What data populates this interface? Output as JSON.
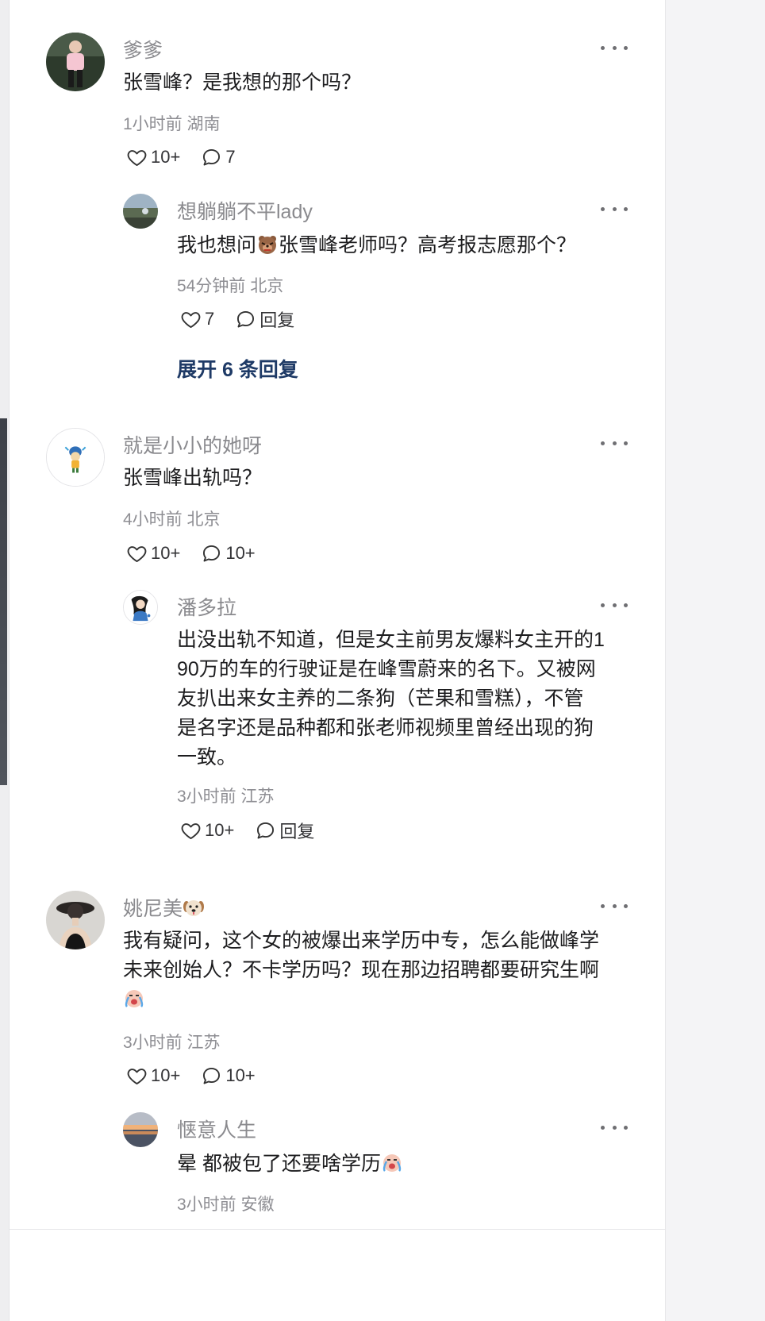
{
  "comments": [
    {
      "author": "爹爹",
      "content": "张雪峰？是我想的那个吗？",
      "meta": "1小时前 湖南",
      "likes": "10+",
      "replies": "7",
      "sub": {
        "author": "想躺躺不平lady",
        "content_before": "我也想问",
        "content_emoji": "bear-face-emoji",
        "content_after": "张雪峰老师吗？高考报志愿那个？",
        "meta": "54分钟前 北京",
        "likes": "7",
        "reply_label": "回复"
      },
      "expand": "展开 6 条回复"
    },
    {
      "author": "就是小小的她呀",
      "content": "张雪峰出轨吗？",
      "meta": "4小时前 北京",
      "likes": "10+",
      "replies": "10+",
      "sub": {
        "author": "潘多拉",
        "content_lines": [
          "出没出轨不知道，但是女主前男友爆料女主开的1",
          "90万的车的行驶证是在峰雪蔚来的名下。又被网",
          "友扒出来女主养的二条狗（芒果和雪糕），不管",
          "是名字还是品种都和张老师视频里曾经出现的狗",
          "一致。"
        ],
        "meta": "3小时前 江苏",
        "likes": "10+",
        "reply_label": "回复"
      }
    },
    {
      "author": "姚尼美",
      "author_emoji": "dog-face-emoji",
      "content_lines": [
        "我有疑问，这个女的被爆出来学历中专，怎么能做峰学",
        "未来创始人？不卡学历吗？现在那边招聘都要研究生啊"
      ],
      "content_emoji": "crying-face-emoji",
      "meta": "3小时前 江苏",
      "likes": "10+",
      "replies": "10+",
      "sub": {
        "author": "惬意人生",
        "content": "晕 都被包了还要啥学历",
        "content_emoji": "crying-face-emoji",
        "meta": "3小时前 安徽"
      }
    }
  ],
  "icons": {
    "like": "heart-outline-icon",
    "comment": "speech-bubble-icon",
    "more": "ellipsis-icon"
  },
  "colors": {
    "link": "#1e3a66",
    "text": "#1d1d1f",
    "secondary": "#8e8e93"
  }
}
